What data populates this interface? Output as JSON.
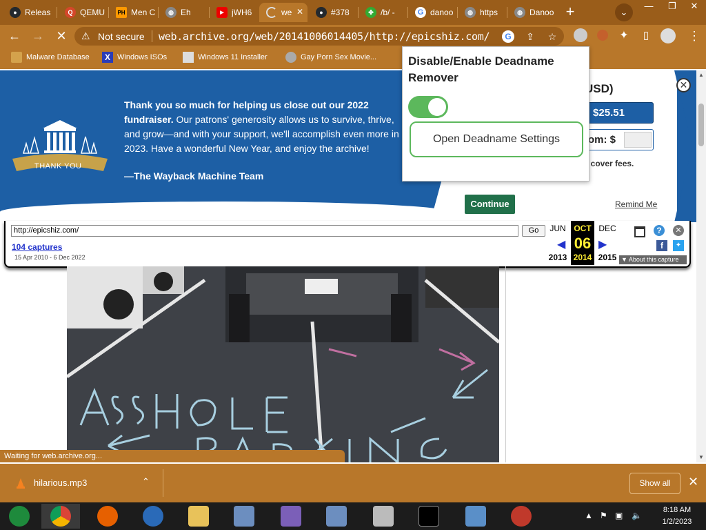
{
  "tabs": [
    {
      "label": "Releas",
      "icon": "github-icon",
      "color": "#24292e"
    },
    {
      "label": "QEMU",
      "icon": "qemu-icon",
      "color": "#d4472a"
    },
    {
      "label": "Men C",
      "icon": "ph-icon",
      "color": "#f90"
    },
    {
      "label": "Eh",
      "icon": "globe-icon",
      "color": "#888"
    },
    {
      "label": "jWH6",
      "icon": "youtube-icon",
      "color": "#e00"
    },
    {
      "label": "we",
      "icon": "loading-icon",
      "color": "#aaa"
    },
    {
      "label": "#378",
      "icon": "github-icon",
      "color": "#24292e"
    },
    {
      "label": "/b/ -",
      "icon": "clover-icon",
      "color": "#3a3"
    },
    {
      "label": "danoo",
      "icon": "google-icon",
      "color": "#fff"
    },
    {
      "label": "https",
      "icon": "globe-icon",
      "color": "#888"
    },
    {
      "label": "Danoo",
      "icon": "globe-icon",
      "color": "#888"
    }
  ],
  "browser": {
    "not_secure": "Not secure",
    "url": "web.archive.org/web/20141006014405/http://epicshiz.com/"
  },
  "bookmarks": [
    {
      "label": "Malware Database",
      "icon": "bookmark-icon"
    },
    {
      "label": "Windows ISOs",
      "icon": "x-icon"
    },
    {
      "label": "Windows 11 Installer",
      "icon": "image-icon"
    },
    {
      "label": "Gay Porn Sex Movie...",
      "icon": "globe-icon"
    }
  ],
  "banner": {
    "msg_bold": "Thank you so much for helping us close out our 2022 fundraiser.",
    "msg_rest": " Our patrons' generosity allows us to survive, thrive, and grow—and with your support, we'll accomplish even more in 2023. Have a wonderful New Year, and enjoy the archive!",
    "signature": "—The Wayback Machine Team",
    "logo_text": "THANK YOU",
    "usd": "USD)",
    "amount": "$25.51",
    "custom_label": "om: $",
    "fees": "o cover fees.",
    "continue": "Continue",
    "remind": "Remind Me"
  },
  "wayback": {
    "url": "http://epicshiz.com/",
    "go": "Go",
    "captures": "104 captures",
    "range": "15 Apr 2010 - 6 Dec 2022",
    "prev_month": "JUN",
    "cur_month": "OCT",
    "cur_day": "06",
    "next_month": "DEC",
    "prev_year": "2013",
    "cur_year": "2014",
    "next_year": "2015",
    "about": "About this capture"
  },
  "popup": {
    "title": "Disable/Enable Deadname Remover",
    "toggle_on": true,
    "button": "Open Deadname Settings"
  },
  "status": "Waiting for web.archive.org...",
  "download": {
    "file": "hilarious.mp3",
    "show_all": "Show all"
  },
  "clock": {
    "time": "8:18 AM",
    "date": "1/2/2023"
  }
}
